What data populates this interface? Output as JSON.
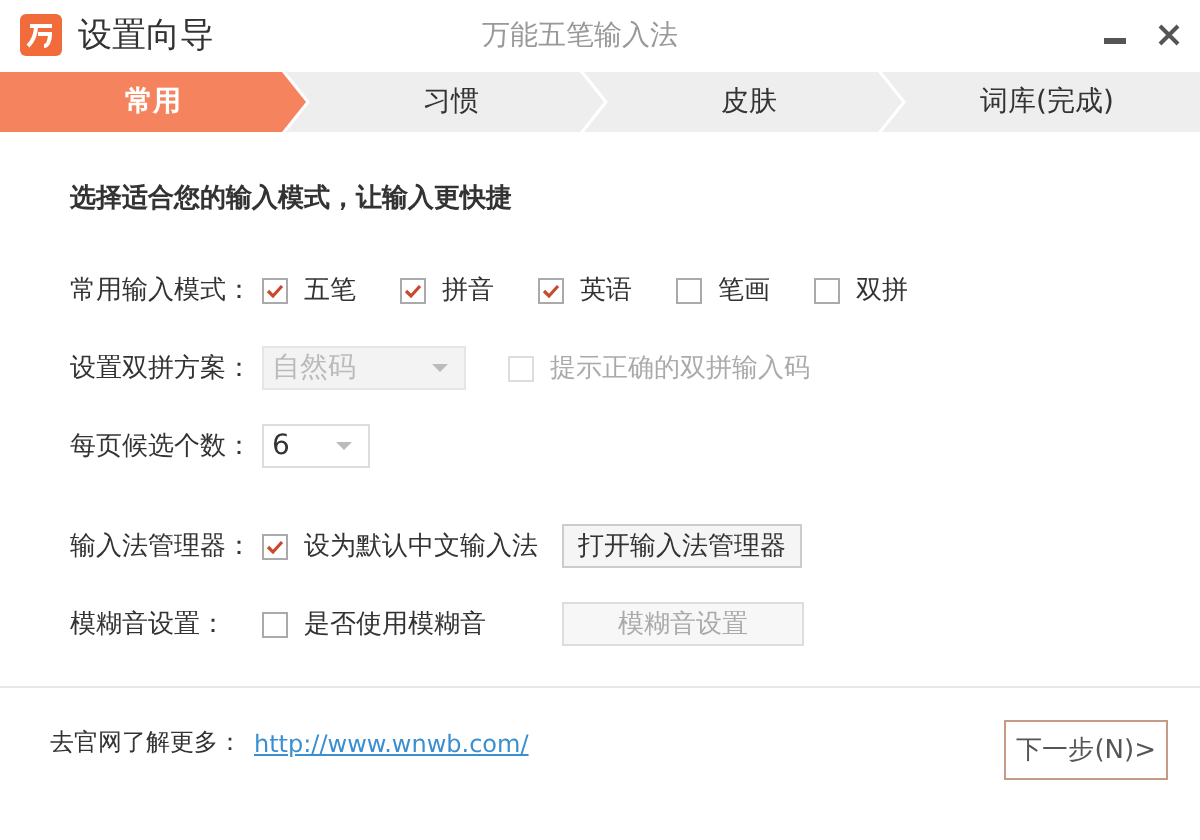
{
  "window": {
    "title": "设置向导",
    "app_name": "万能五笔输入法"
  },
  "steps": [
    {
      "label": "常用",
      "selected": true
    },
    {
      "label": "习惯",
      "selected": false
    },
    {
      "label": "皮肤",
      "selected": false
    },
    {
      "label": "词库(完成)",
      "selected": false
    }
  ],
  "heading": "选择适合您的输入模式，让输入更快捷",
  "modes": {
    "label": "常用输入模式：",
    "options": [
      {
        "label": "五笔",
        "checked": true
      },
      {
        "label": "拼音",
        "checked": true
      },
      {
        "label": "英语",
        "checked": true
      },
      {
        "label": "笔画",
        "checked": false
      },
      {
        "label": "双拼",
        "checked": false
      }
    ]
  },
  "shuangpin": {
    "label": "设置双拼方案：",
    "scheme": {
      "value": "自然码",
      "disabled": true
    },
    "hint": {
      "label": "提示正确的双拼输入码",
      "checked": false,
      "disabled": true
    }
  },
  "candidates": {
    "label": "每页候选个数：",
    "value": "6"
  },
  "manager": {
    "label": "输入法管理器：",
    "option": {
      "label": "设为默认中文输入法",
      "checked": true
    },
    "button": {
      "label": "打开输入法管理器",
      "disabled": false
    }
  },
  "fuzzy": {
    "label": "模糊音设置：",
    "option": {
      "label": "是否使用模糊音",
      "checked": false
    },
    "button": {
      "label": "模糊音设置",
      "disabled": true
    }
  },
  "footer": {
    "text": "去官网了解更多：",
    "link": "http://www.wnwb.com/"
  },
  "next_button": "下一步(N)>"
}
